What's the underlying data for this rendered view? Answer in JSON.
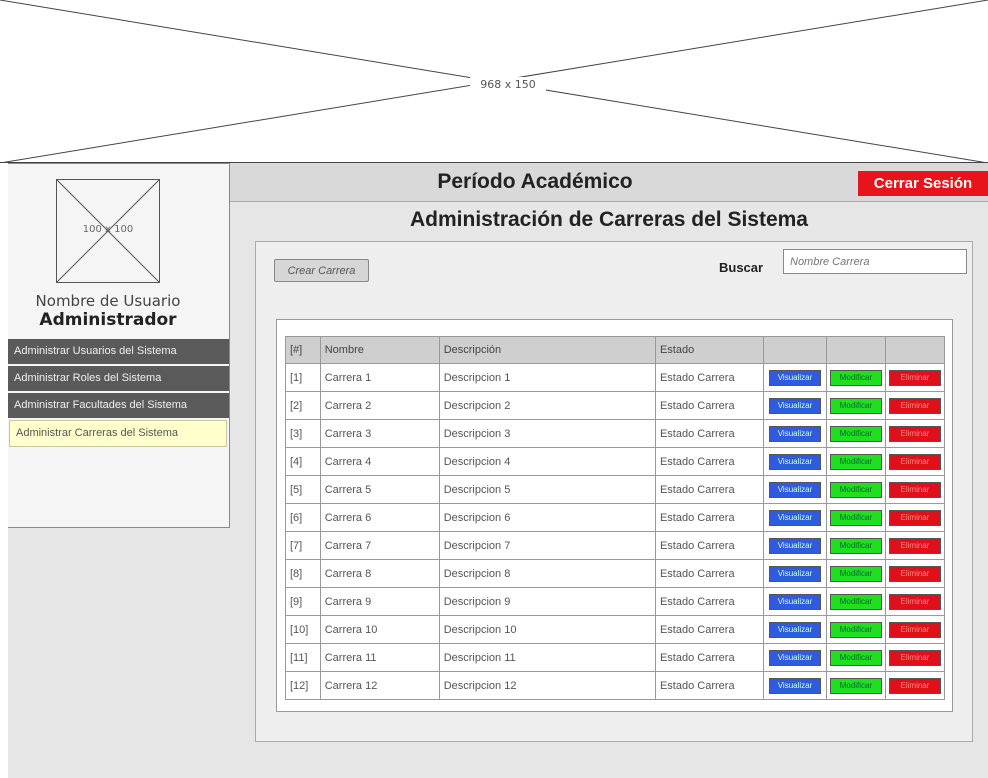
{
  "banner": {
    "label": "968 x 150"
  },
  "sidebar": {
    "avatar_label": "100 x 100",
    "user_name": "Nombre de Usuario",
    "user_role": "Administrador",
    "items": [
      {
        "label": "Administrar Usuarios del Sistema",
        "active": false
      },
      {
        "label": "Administrar Roles del Sistema",
        "active": false
      },
      {
        "label": "Administrar Facultades del Sistema",
        "active": false
      },
      {
        "label": "Administrar Carreras del Sistema",
        "active": true
      }
    ]
  },
  "header": {
    "period": "Período Académico",
    "logout": "Cerrar Sesión"
  },
  "page_title": "Administración de Carreras del Sistema",
  "toolbar": {
    "create_label": "Crear Carrera",
    "search_label": "Buscar",
    "search_placeholder": "Nombre Carrera"
  },
  "table": {
    "headers": [
      "[#]",
      "Nombre",
      "Descripción",
      "Estado",
      "",
      "",
      ""
    ],
    "actions": {
      "view": "Visualizar",
      "edit": "Modificar",
      "delete": "Eliminar"
    },
    "rows": [
      [
        "[1]",
        "Carrera 1",
        "Descripcion 1",
        "Estado Carrera"
      ],
      [
        "[2]",
        "Carrera 2",
        "Descripcion 2",
        "Estado Carrera"
      ],
      [
        "[3]",
        "Carrera 3",
        "Descripcion 3",
        "Estado Carrera"
      ],
      [
        "[4]",
        "Carrera 4",
        "Descripcion 4",
        "Estado Carrera"
      ],
      [
        "[5]",
        "Carrera 5",
        "Descripcion 5",
        "Estado Carrera"
      ],
      [
        "[6]",
        "Carrera 6",
        "Descripcion 6",
        "Estado Carrera"
      ],
      [
        "[7]",
        "Carrera 7",
        "Descripcion 7",
        "Estado Carrera"
      ],
      [
        "[8]",
        "Carrera 8",
        "Descripcion 8",
        "Estado Carrera"
      ],
      [
        "[9]",
        "Carrera 9",
        "Descripcion 9",
        "Estado Carrera"
      ],
      [
        "[10]",
        "Carrera 10",
        "Descripcion 10",
        "Estado Carrera"
      ],
      [
        "[11]",
        "Carrera 11",
        "Descripcion 11",
        "Estado Carrera"
      ],
      [
        "[12]",
        "Carrera 12",
        "Descripcion 12",
        "Estado Carrera"
      ]
    ]
  },
  "colors": {
    "logout": "#e8141c",
    "view": "#2f5be0",
    "edit": "#1fe01f",
    "delete": "#e0101a",
    "active_nav": "#ffffcc"
  }
}
